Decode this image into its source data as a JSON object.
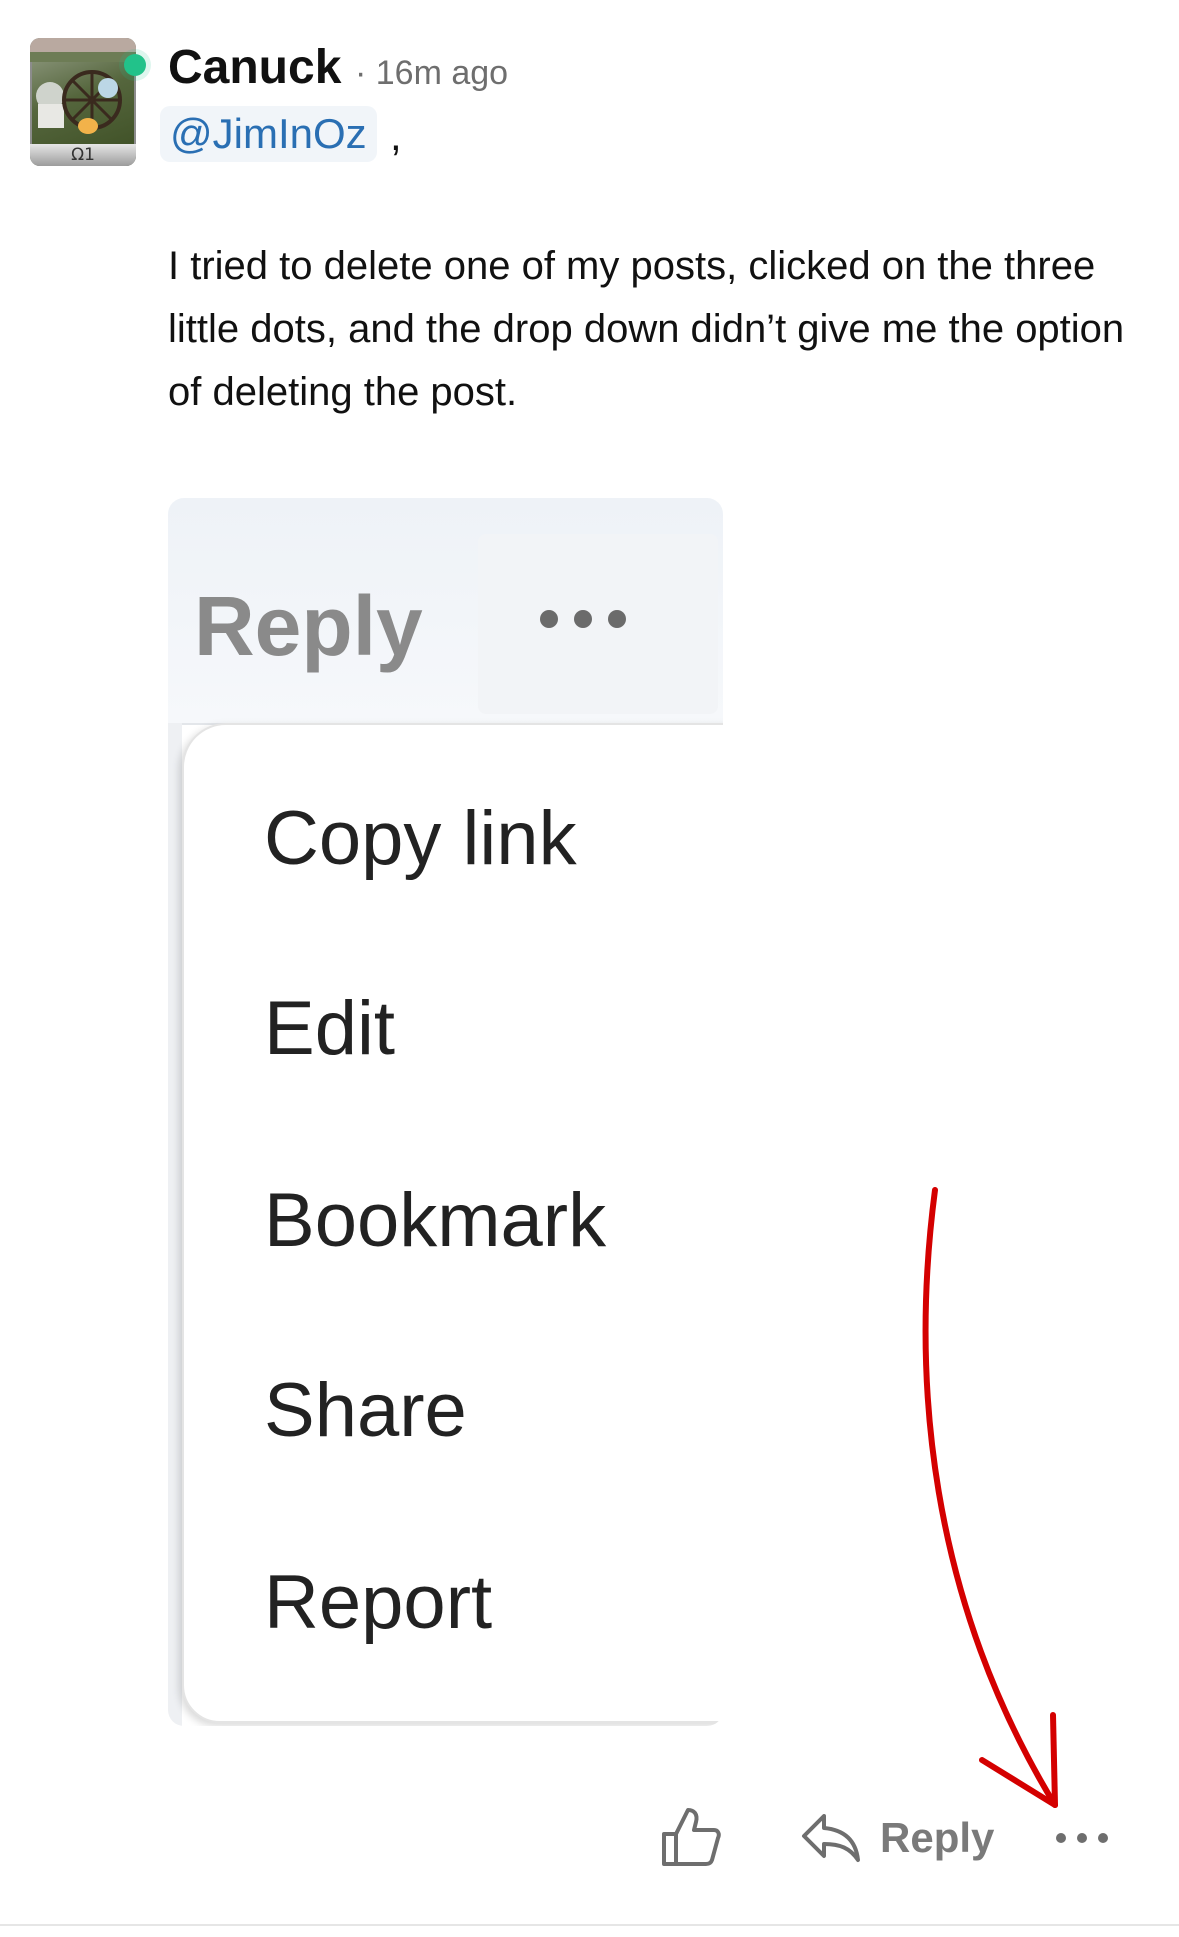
{
  "post": {
    "author": "Canuck",
    "timestamp": "· 16m ago",
    "avatar_badge": "Ω1",
    "online_color": "#22c28a",
    "mention": "@JimInOz",
    "mention_suffix": ",",
    "body": "I tried to delete one of my posts, clicked on the three little dots, and the drop down didn’t give me the option of deleting the post."
  },
  "embedded_screenshot": {
    "reply_label": "Reply",
    "menu_items": [
      "Copy link",
      "Edit",
      "Bookmark",
      "Share",
      "Report"
    ]
  },
  "actions": {
    "like_icon": "thumbs-up-icon",
    "reply_icon": "reply-arrow-icon",
    "reply_label": "Reply",
    "more_icon": "more-dots-icon"
  },
  "annotation": {
    "arrow_color": "#d40000",
    "arrow_icon": "red-arrow-annotation"
  }
}
